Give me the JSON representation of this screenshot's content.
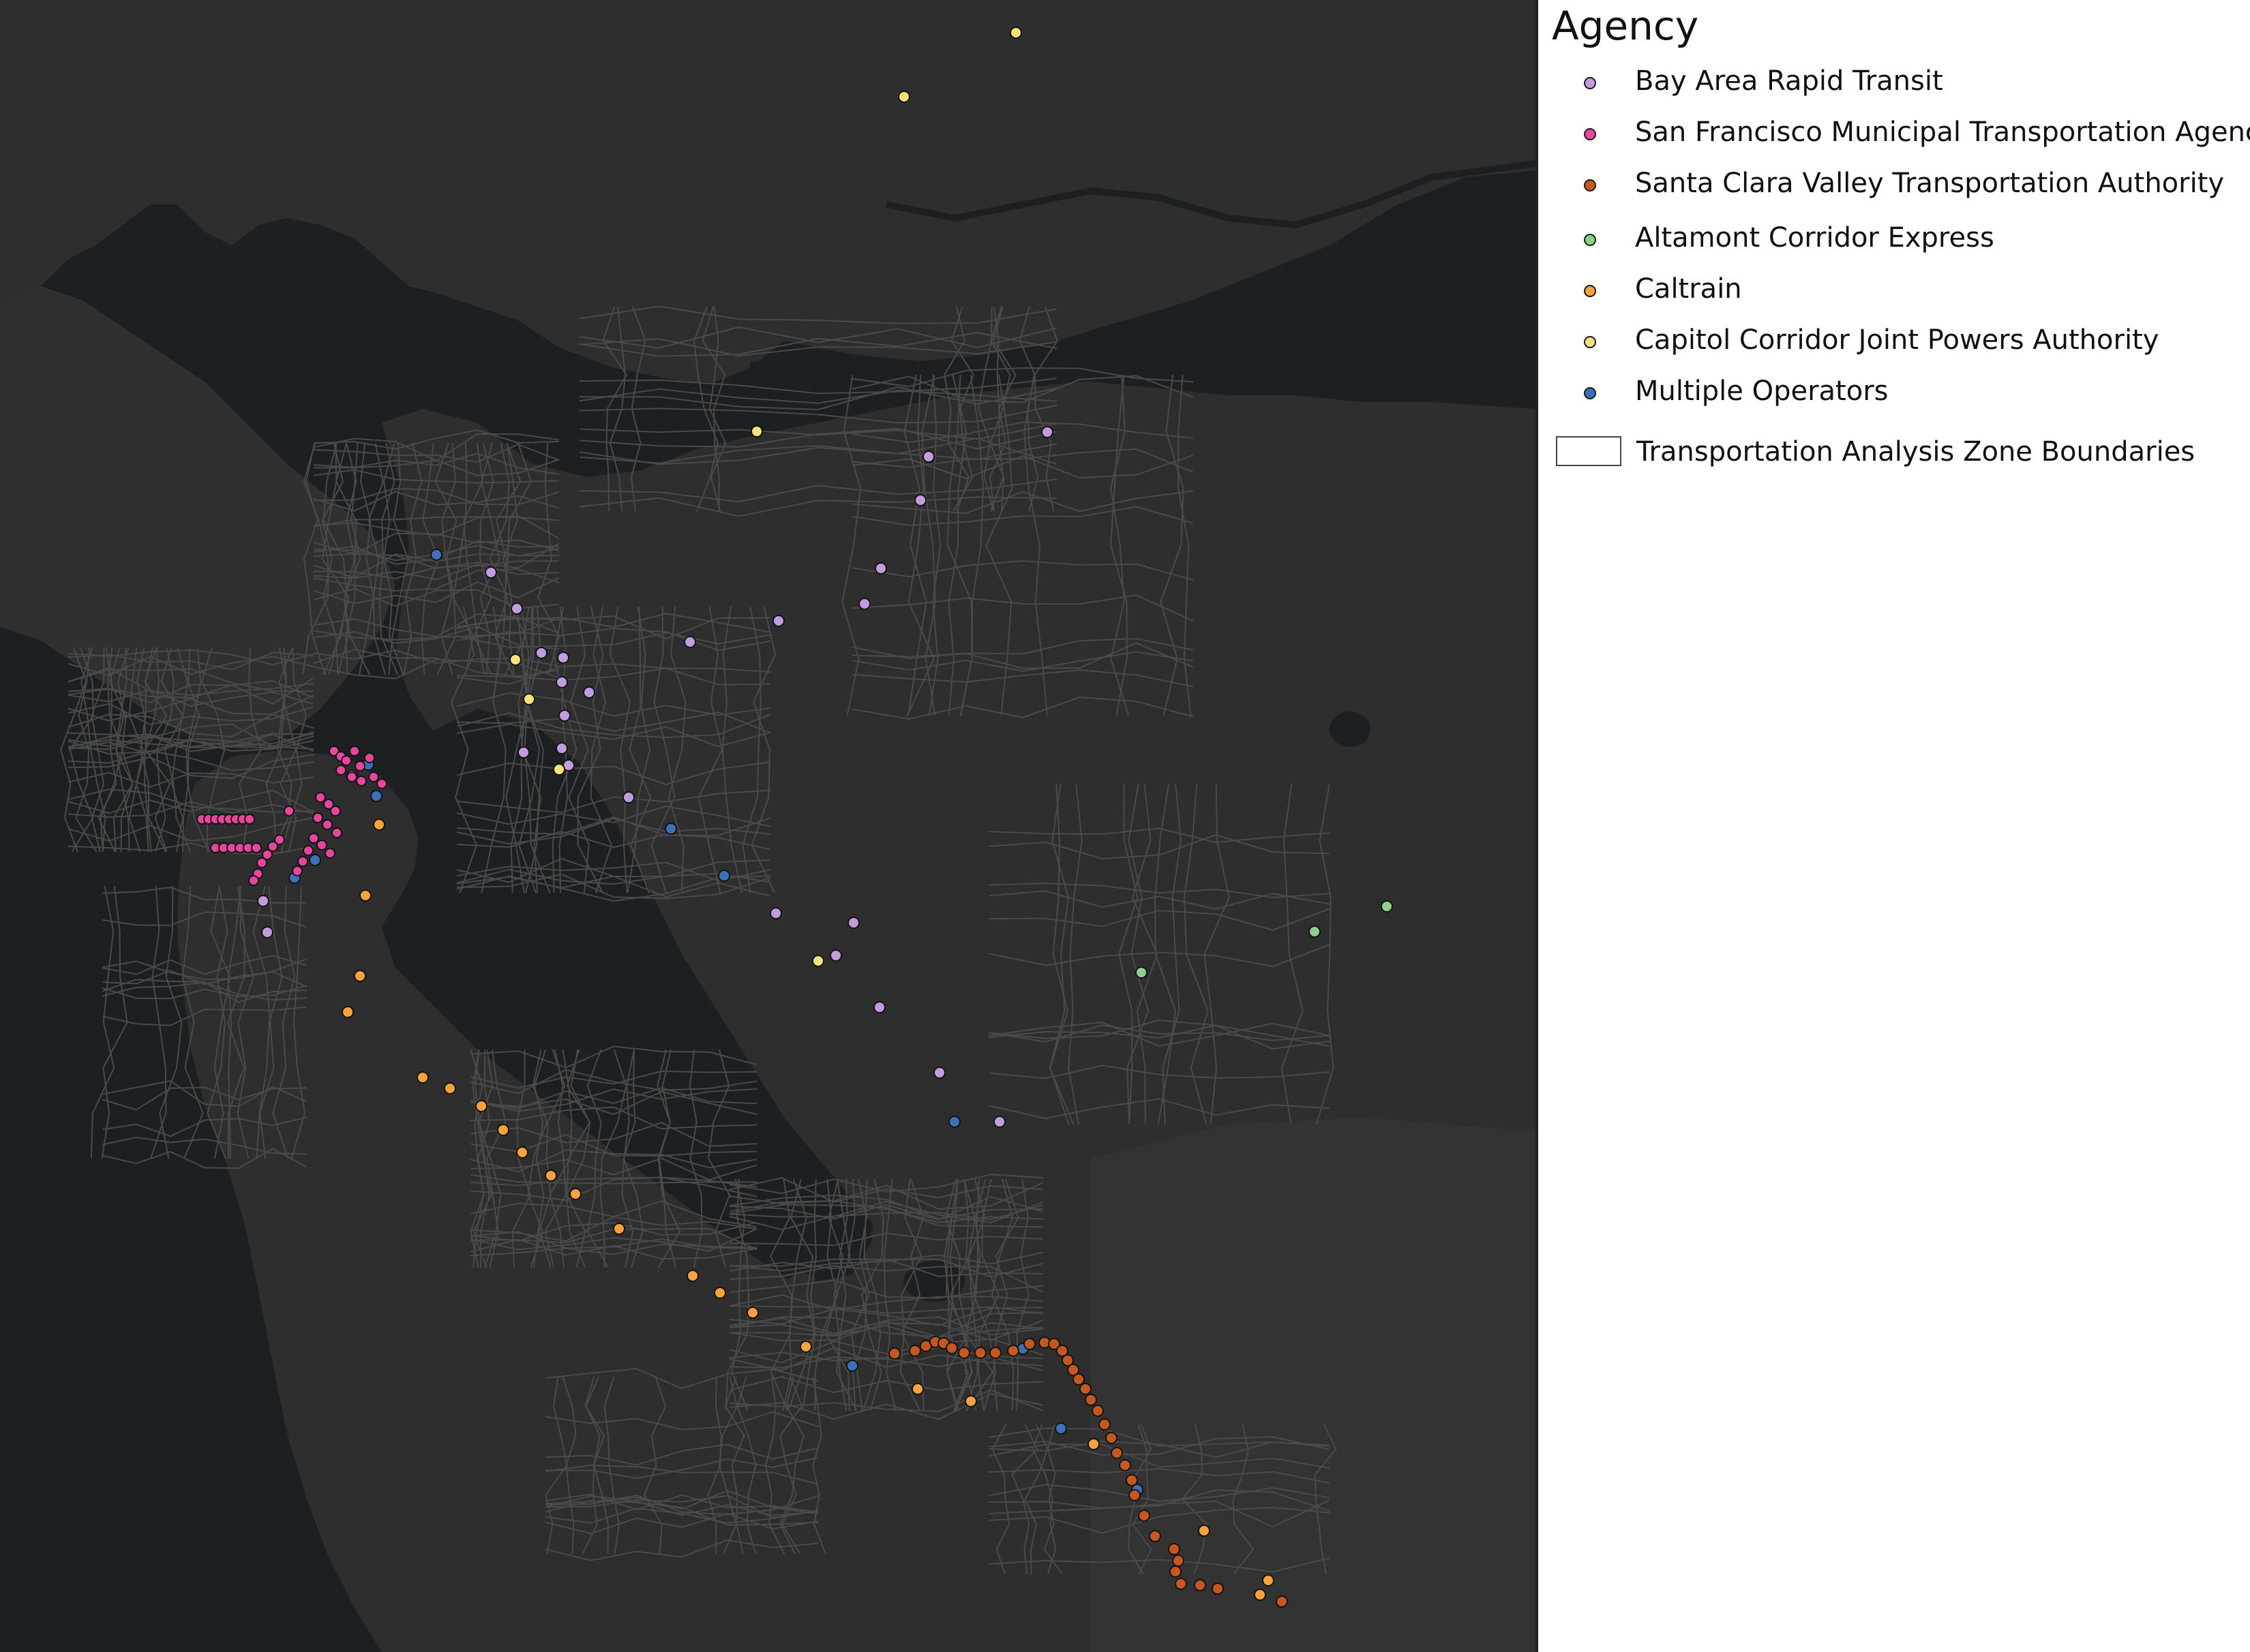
{
  "legend": {
    "title": "Agency",
    "agencies": [
      {
        "label": "Bay Area Rapid Transit",
        "color": "#c39bdf"
      },
      {
        "label": "San Francisco Municipal Transportation Agency",
        "color": "#e8459f"
      },
      {
        "label": "Santa Clara Valley Transportation Authority",
        "color": "#c8571f"
      },
      {
        "label": "Altamont Corridor Express",
        "color": "#8ed08b"
      },
      {
        "label": "Caltrain",
        "color": "#f7a23a"
      },
      {
        "label": "Capitol Corridor Joint Powers Authority",
        "color": "#f6e27a"
      },
      {
        "label": "Multiple Operators",
        "color": "#3c70b8"
      }
    ],
    "boundary_label": "Transportation Analysis Zone Boundaries",
    "boundary_color": "#ffffff"
  },
  "map_colors": {
    "water": "#1c2022",
    "land": "#2e2e2e",
    "land_alt": "#333333",
    "zone_line": "#4a4a4a",
    "dot_outline": "#141414"
  }
}
